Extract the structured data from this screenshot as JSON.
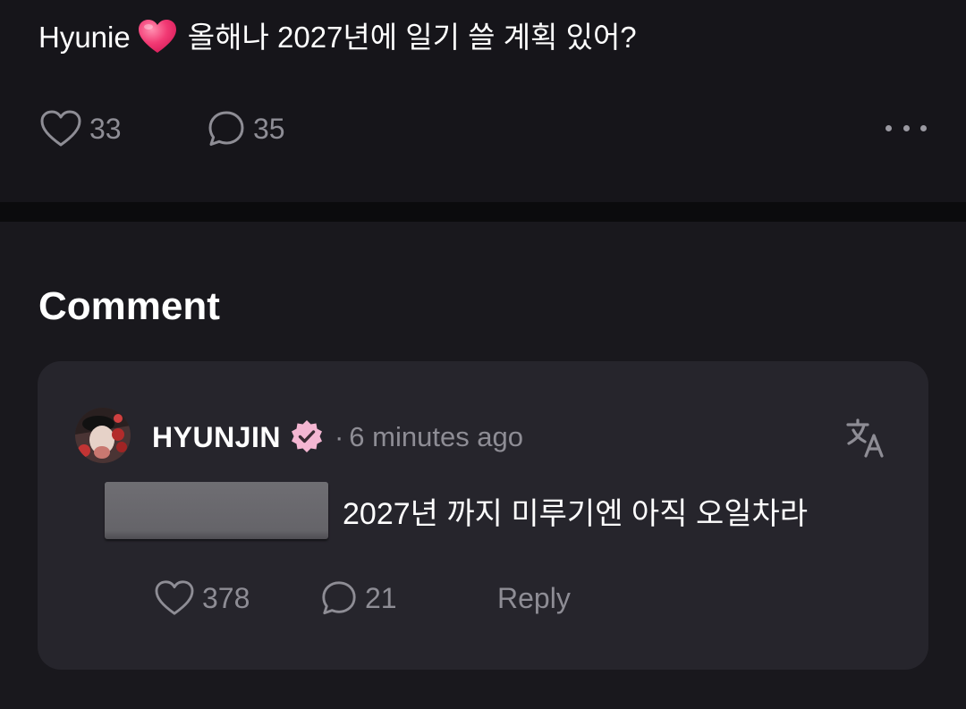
{
  "post": {
    "author": "Hyunie",
    "emoji": "heart-emoji",
    "text": "올해나 2027년에 일기 쓸 계획 있어?",
    "likes": "33",
    "comments": "35"
  },
  "comments_section": {
    "title": "Comment",
    "comment": {
      "username": "HYUNJIN",
      "separator": "·",
      "time": "6 minutes ago",
      "text": "2027년 까지 미루기엔 아직 오일차라",
      "likes": "378",
      "replies": "21",
      "reply_label": "Reply"
    }
  },
  "colors": {
    "background": "#19181d",
    "card": "#26252c",
    "muted_text": "#8e8d95",
    "badge_pink": "#f4b6d2",
    "heart_emoji": "#f23a74"
  },
  "icons": {
    "like": "heart-outline-icon",
    "comment": "speech-bubble-icon",
    "more": "more-dots-icon",
    "verified": "verified-badge-icon",
    "translate": "translate-icon"
  }
}
